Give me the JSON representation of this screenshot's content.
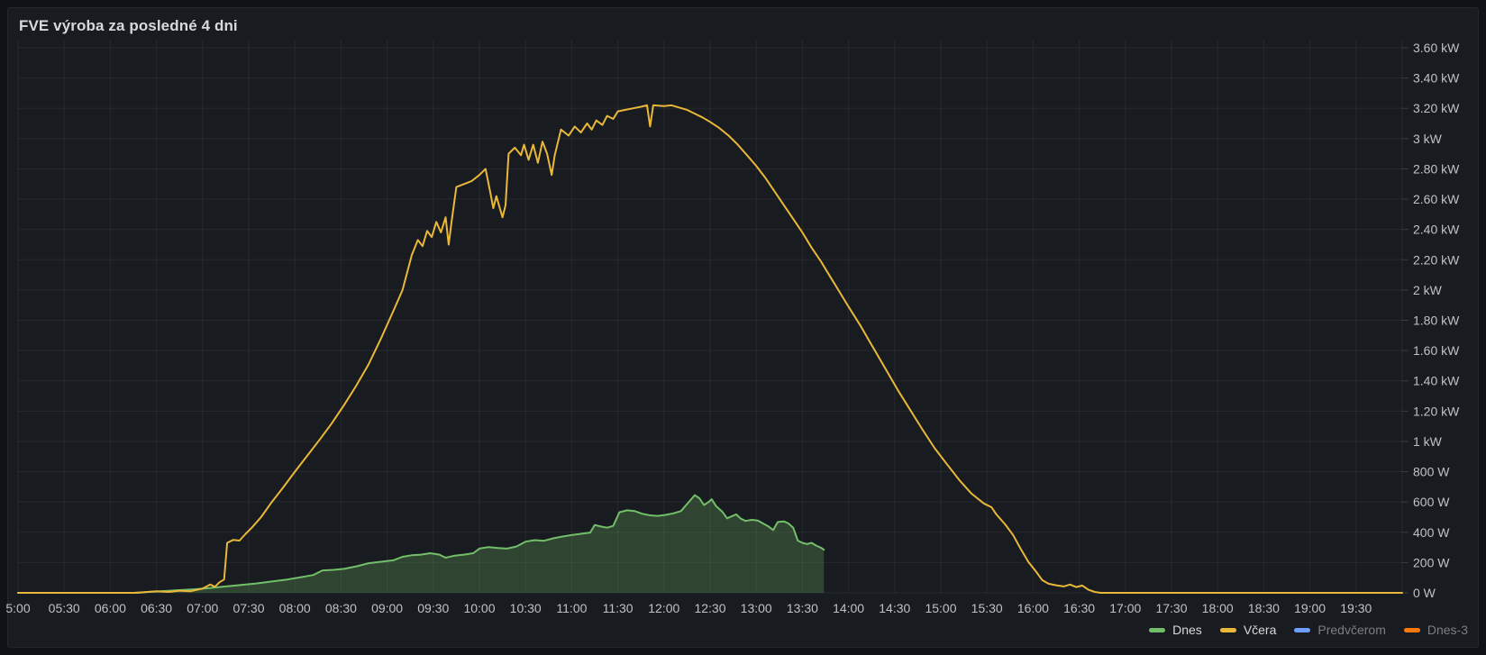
{
  "panel": {
    "title": "FVE výroba za posledné 4 dni"
  },
  "colors": {
    "page_background": "#111217",
    "panel_background": "#181b1f",
    "panel_border": "#25272e",
    "title_text": "#d8d9da",
    "axis_text": "#bfc1c9",
    "grid_line": "rgba(204,204,220,0.08)",
    "axis_tick": "rgba(204,204,220,0.18)",
    "legend_text": "#d8d9da",
    "legend_dim_text": "#7b7f85",
    "series_green": "#73bf69",
    "series_yellow": "#eab839",
    "series_blue": "#6e9fff",
    "series_orange": "#ff780a",
    "green_fill": "rgba(115,191,105,0.25)"
  },
  "legend": {
    "items": [
      {
        "label": "Dnes",
        "color": "#73bf69",
        "dimmed": false
      },
      {
        "label": "Včera",
        "color": "#eab839",
        "dimmed": false
      },
      {
        "label": "Predvčerom",
        "color": "#6e9fff",
        "dimmed": true
      },
      {
        "label": "Dnes-3",
        "color": "#ff780a",
        "dimmed": true
      }
    ]
  },
  "chart_data": {
    "type": "line",
    "title": "FVE výroba za posledné 4 dni",
    "xlabel": "",
    "ylabel": "",
    "grid": true,
    "legend_position": "bottom-right",
    "y_axis": {
      "unit": "W",
      "min": 0,
      "max": 3600,
      "tick_step": 200,
      "tick_labels": [
        "0 W",
        "200 W",
        "400 W",
        "600 W",
        "800 W",
        "1 kW",
        "1.20 kW",
        "1.40 kW",
        "1.60 kW",
        "1.80 kW",
        "2 kW",
        "2.20 kW",
        "2.40 kW",
        "2.60 kW",
        "2.80 kW",
        "3 kW",
        "3.20 kW",
        "3.40 kW",
        "3.60 kW"
      ]
    },
    "x_axis": {
      "start": "05:00",
      "end": "20:00",
      "tick_interval_minutes": 30,
      "tick_labels": [
        "5:00",
        "05:30",
        "06:00",
        "06:30",
        "07:00",
        "07:30",
        "08:00",
        "08:30",
        "09:00",
        "09:30",
        "10:00",
        "10:30",
        "11:00",
        "11:30",
        "12:00",
        "12:30",
        "13:00",
        "13:30",
        "14:00",
        "14:30",
        "15:00",
        "15:30",
        "16:00",
        "16:30",
        "17:00",
        "17:30",
        "18:00",
        "18:30",
        "19:00",
        "19:30"
      ]
    },
    "series": [
      {
        "name": "Dnes",
        "color": "#73bf69",
        "fill": true,
        "visible": true,
        "line_width": 2,
        "points": [
          [
            "05:00",
            0
          ],
          [
            "06:00",
            0
          ],
          [
            "06:18",
            0
          ],
          [
            "06:25",
            6
          ],
          [
            "06:35",
            12
          ],
          [
            "06:45",
            18
          ],
          [
            "06:55",
            24
          ],
          [
            "07:05",
            32
          ],
          [
            "07:15",
            42
          ],
          [
            "07:25",
            52
          ],
          [
            "07:35",
            62
          ],
          [
            "07:45",
            75
          ],
          [
            "07:55",
            88
          ],
          [
            "08:05",
            105
          ],
          [
            "08:12",
            118
          ],
          [
            "08:18",
            148
          ],
          [
            "08:25",
            152
          ],
          [
            "08:32",
            158
          ],
          [
            "08:40",
            175
          ],
          [
            "08:48",
            196
          ],
          [
            "08:56",
            205
          ],
          [
            "09:04",
            215
          ],
          [
            "09:10",
            238
          ],
          [
            "09:16",
            248
          ],
          [
            "09:22",
            252
          ],
          [
            "09:28",
            262
          ],
          [
            "09:34",
            252
          ],
          [
            "09:38",
            232
          ],
          [
            "09:44",
            246
          ],
          [
            "09:50",
            252
          ],
          [
            "09:56",
            262
          ],
          [
            "10:00",
            292
          ],
          [
            "10:06",
            302
          ],
          [
            "10:12",
            296
          ],
          [
            "10:18",
            292
          ],
          [
            "10:24",
            306
          ],
          [
            "10:30",
            338
          ],
          [
            "10:36",
            348
          ],
          [
            "10:42",
            344
          ],
          [
            "10:48",
            360
          ],
          [
            "10:54",
            372
          ],
          [
            "11:00",
            382
          ],
          [
            "11:06",
            390
          ],
          [
            "11:12",
            398
          ],
          [
            "11:15",
            448
          ],
          [
            "11:19",
            438
          ],
          [
            "11:23",
            430
          ],
          [
            "11:27",
            442
          ],
          [
            "11:31",
            532
          ],
          [
            "11:36",
            545
          ],
          [
            "11:41",
            540
          ],
          [
            "11:46",
            522
          ],
          [
            "11:51",
            512
          ],
          [
            "11:56",
            508
          ],
          [
            "12:01",
            515
          ],
          [
            "12:06",
            525
          ],
          [
            "12:11",
            540
          ],
          [
            "12:16",
            598
          ],
          [
            "12:20",
            645
          ],
          [
            "12:23",
            625
          ],
          [
            "12:26",
            580
          ],
          [
            "12:29",
            600
          ],
          [
            "12:31",
            618
          ],
          [
            "12:34",
            572
          ],
          [
            "12:38",
            535
          ],
          [
            "12:41",
            492
          ],
          [
            "12:44",
            505
          ],
          [
            "12:47",
            518
          ],
          [
            "12:50",
            490
          ],
          [
            "12:53",
            475
          ],
          [
            "12:57",
            482
          ],
          [
            "13:01",
            478
          ],
          [
            "13:05",
            455
          ],
          [
            "13:08",
            438
          ],
          [
            "13:11",
            415
          ],
          [
            "13:14",
            468
          ],
          [
            "13:18",
            472
          ],
          [
            "13:21",
            458
          ],
          [
            "13:24",
            430
          ],
          [
            "13:27",
            345
          ],
          [
            "13:30",
            330
          ],
          [
            "13:33",
            322
          ],
          [
            "13:36",
            330
          ],
          [
            "13:39",
            312
          ],
          [
            "13:42",
            298
          ],
          [
            "13:44",
            285
          ]
        ]
      },
      {
        "name": "Včera",
        "color": "#eab839",
        "fill": false,
        "visible": true,
        "line_width": 2,
        "points": [
          [
            "05:00",
            0
          ],
          [
            "05:30",
            0
          ],
          [
            "06:00",
            0
          ],
          [
            "06:15",
            0
          ],
          [
            "06:22",
            5
          ],
          [
            "06:30",
            10
          ],
          [
            "06:38",
            6
          ],
          [
            "06:45",
            14
          ],
          [
            "06:52",
            10
          ],
          [
            "07:00",
            28
          ],
          [
            "07:05",
            55
          ],
          [
            "07:08",
            40
          ],
          [
            "07:11",
            70
          ],
          [
            "07:14",
            88
          ],
          [
            "07:16",
            330
          ],
          [
            "07:20",
            350
          ],
          [
            "07:24",
            345
          ],
          [
            "07:28",
            390
          ],
          [
            "07:32",
            430
          ],
          [
            "07:38",
            500
          ],
          [
            "07:45",
            600
          ],
          [
            "07:52",
            690
          ],
          [
            "08:00",
            800
          ],
          [
            "08:08",
            905
          ],
          [
            "08:16",
            1010
          ],
          [
            "08:24",
            1120
          ],
          [
            "08:32",
            1240
          ],
          [
            "08:40",
            1370
          ],
          [
            "08:48",
            1510
          ],
          [
            "08:56",
            1680
          ],
          [
            "09:04",
            1860
          ],
          [
            "09:10",
            2000
          ],
          [
            "09:16",
            2230
          ],
          [
            "09:20",
            2330
          ],
          [
            "09:23",
            2290
          ],
          [
            "09:26",
            2390
          ],
          [
            "09:29",
            2350
          ],
          [
            "09:32",
            2450
          ],
          [
            "09:35",
            2380
          ],
          [
            "09:38",
            2480
          ],
          [
            "09:40",
            2300
          ],
          [
            "09:42",
            2460
          ],
          [
            "09:45",
            2680
          ],
          [
            "09:50",
            2700
          ],
          [
            "09:55",
            2720
          ],
          [
            "10:00",
            2760
          ],
          [
            "10:04",
            2800
          ],
          [
            "10:07",
            2650
          ],
          [
            "10:09",
            2540
          ],
          [
            "10:11",
            2620
          ],
          [
            "10:13",
            2550
          ],
          [
            "10:15",
            2480
          ],
          [
            "10:17",
            2560
          ],
          [
            "10:19",
            2900
          ],
          [
            "10:23",
            2940
          ],
          [
            "10:27",
            2890
          ],
          [
            "10:29",
            2960
          ],
          [
            "10:32",
            2860
          ],
          [
            "10:35",
            2960
          ],
          [
            "10:38",
            2840
          ],
          [
            "10:41",
            2980
          ],
          [
            "10:44",
            2900
          ],
          [
            "10:47",
            2760
          ],
          [
            "10:49",
            2890
          ],
          [
            "10:53",
            3060
          ],
          [
            "10:58",
            3020
          ],
          [
            "11:02",
            3080
          ],
          [
            "11:06",
            3040
          ],
          [
            "11:10",
            3100
          ],
          [
            "11:13",
            3060
          ],
          [
            "11:16",
            3120
          ],
          [
            "11:20",
            3090
          ],
          [
            "11:23",
            3150
          ],
          [
            "11:27",
            3130
          ],
          [
            "11:30",
            3180
          ],
          [
            "11:35",
            3190
          ],
          [
            "11:40",
            3200
          ],
          [
            "11:45",
            3210
          ],
          [
            "11:49",
            3220
          ],
          [
            "11:51",
            3080
          ],
          [
            "11:53",
            3220
          ],
          [
            "12:00",
            3215
          ],
          [
            "12:05",
            3220
          ],
          [
            "12:10",
            3205
          ],
          [
            "12:15",
            3190
          ],
          [
            "12:20",
            3165
          ],
          [
            "12:25",
            3140
          ],
          [
            "12:30",
            3110
          ],
          [
            "12:36",
            3070
          ],
          [
            "12:42",
            3020
          ],
          [
            "12:48",
            2960
          ],
          [
            "12:54",
            2890
          ],
          [
            "13:00",
            2820
          ],
          [
            "13:06",
            2740
          ],
          [
            "13:12",
            2650
          ],
          [
            "13:18",
            2560
          ],
          [
            "13:24",
            2470
          ],
          [
            "13:30",
            2380
          ],
          [
            "13:36",
            2280
          ],
          [
            "13:42",
            2190
          ],
          [
            "13:48",
            2090
          ],
          [
            "13:54",
            1990
          ],
          [
            "14:00",
            1890
          ],
          [
            "14:08",
            1760
          ],
          [
            "14:16",
            1620
          ],
          [
            "14:24",
            1480
          ],
          [
            "14:32",
            1340
          ],
          [
            "14:40",
            1210
          ],
          [
            "14:48",
            1080
          ],
          [
            "14:56",
            955
          ],
          [
            "15:04",
            850
          ],
          [
            "15:12",
            745
          ],
          [
            "15:20",
            655
          ],
          [
            "15:28",
            590
          ],
          [
            "15:33",
            565
          ],
          [
            "15:36",
            520
          ],
          [
            "15:42",
            450
          ],
          [
            "15:47",
            382
          ],
          [
            "15:52",
            290
          ],
          [
            "15:57",
            203
          ],
          [
            "16:02",
            140
          ],
          [
            "16:06",
            84
          ],
          [
            "16:10",
            60
          ],
          [
            "16:15",
            50
          ],
          [
            "16:20",
            42
          ],
          [
            "16:24",
            55
          ],
          [
            "16:28",
            38
          ],
          [
            "16:32",
            48
          ],
          [
            "16:36",
            20
          ],
          [
            "16:40",
            6
          ],
          [
            "16:44",
            0
          ],
          [
            "17:00",
            0
          ],
          [
            "17:30",
            0
          ],
          [
            "18:00",
            0
          ],
          [
            "18:30",
            0
          ],
          [
            "19:00",
            0
          ],
          [
            "19:30",
            0
          ],
          [
            "20:00",
            0
          ]
        ]
      },
      {
        "name": "Predvčerom",
        "color": "#6e9fff",
        "fill": false,
        "visible": false,
        "points": []
      },
      {
        "name": "Dnes-3",
        "color": "#ff780a",
        "fill": false,
        "visible": false,
        "points": []
      }
    ]
  }
}
